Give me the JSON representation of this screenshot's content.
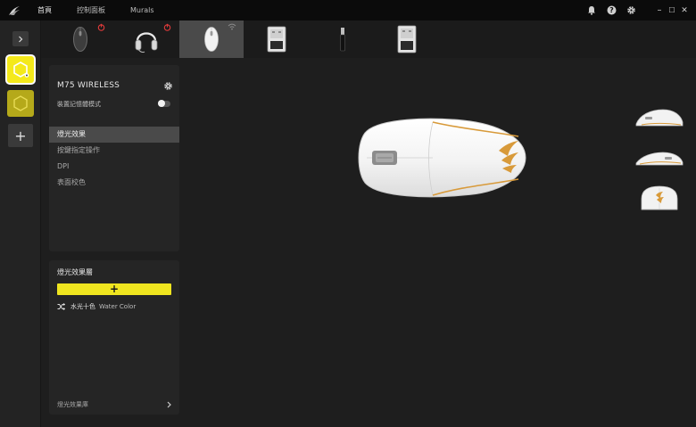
{
  "titlebar": {
    "nav": [
      "首頁",
      "控制面板",
      "Murals"
    ],
    "icons": [
      "corsair-logo",
      "bell-icon",
      "help-icon",
      "settings-icon"
    ],
    "window_controls": [
      "–",
      "☐",
      "✕"
    ]
  },
  "sidebar": {
    "profiles": [
      "profile-1",
      "profile-2"
    ],
    "add_label": "+"
  },
  "devices": [
    {
      "name": "mouse-dark",
      "icon": "mouse-icon"
    },
    {
      "name": "headset",
      "icon": "headset-icon"
    },
    {
      "name": "m75-wireless",
      "icon": "mouse-icon",
      "selected": true
    },
    {
      "name": "usb-receiver",
      "icon": "receiver-icon"
    },
    {
      "name": "usb-stick",
      "icon": "usb-stick-icon"
    },
    {
      "name": "usb-receiver-2",
      "icon": "receiver-icon"
    }
  ],
  "device_panel": {
    "name": "M75 WIRELESS",
    "memory_mode_label": "裝置記憶體模式",
    "memory_mode_on": false,
    "menu": [
      "燈光效果",
      "按鍵指定操作",
      "DPI",
      "表面校色"
    ],
    "active_index": 0
  },
  "lighting_layers": {
    "title": "燈光效果層",
    "add_label": "+",
    "layers": [
      {
        "name": "水光十色",
        "subtitle": "Water Color",
        "icon": "shuffle-icon"
      }
    ],
    "library_label": "燈光效果庫"
  },
  "colors": {
    "accent": "#efe51f",
    "titlebar": "#0b0b0b",
    "panel": "#252525",
    "background": "#1e1e1e",
    "mouse_trim": "#d89a3a"
  }
}
